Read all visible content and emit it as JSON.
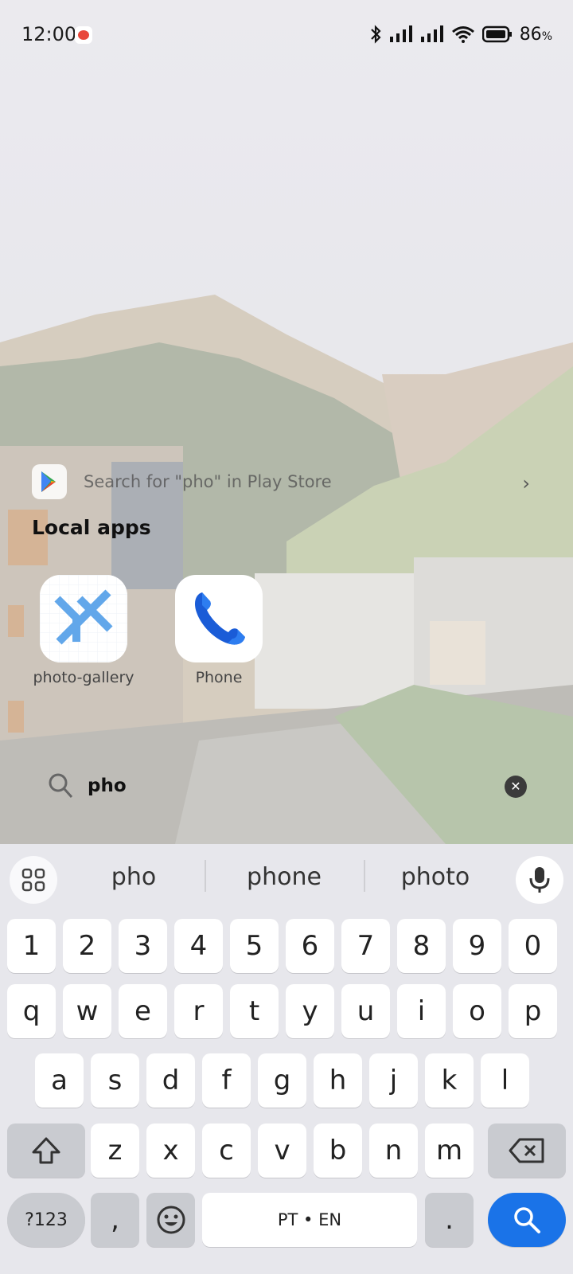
{
  "status_bar": {
    "time": "12:00",
    "battery": "86",
    "battery_unit": "%",
    "icons": [
      "bluetooth-icon",
      "signal-icon",
      "signal-icon",
      "wifi-icon",
      "battery-icon"
    ]
  },
  "play_store": {
    "text": "Search for \"pho\" in Play Store",
    "icon": "play-store-icon"
  },
  "local_apps": {
    "title": "Local apps",
    "apps": [
      {
        "label": "photo-gallery",
        "icon": "photo-gallery-icon"
      },
      {
        "label": "Phone",
        "icon": "phone-icon"
      }
    ]
  },
  "search": {
    "query": "pho",
    "icon": "search-icon"
  },
  "keyboard": {
    "suggestions": [
      "pho",
      "phone",
      "photo"
    ],
    "row_numbers": [
      "1",
      "2",
      "3",
      "4",
      "5",
      "6",
      "7",
      "8",
      "9",
      "0"
    ],
    "row_1": [
      "q",
      "w",
      "e",
      "r",
      "t",
      "y",
      "u",
      "i",
      "o",
      "p"
    ],
    "row_2": [
      "a",
      "s",
      "d",
      "f",
      "g",
      "h",
      "j",
      "k",
      "l"
    ],
    "row_3": [
      "z",
      "x",
      "c",
      "v",
      "b",
      "n",
      "m"
    ],
    "symbols_label": "?123",
    "comma": ",",
    "period": ".",
    "space_label": "PT • EN",
    "accent_color": "#1a73e8"
  }
}
